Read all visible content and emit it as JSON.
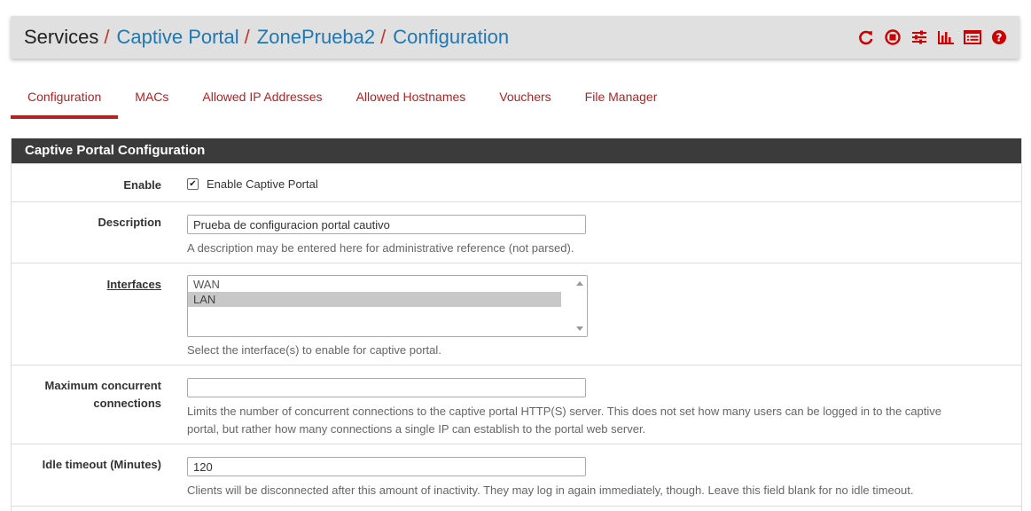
{
  "breadcrumb": {
    "root": "Services",
    "separator": "/",
    "items": [
      "Captive Portal",
      "ZonePrueba2",
      "Configuration"
    ]
  },
  "header_icons": [
    "reload-icon",
    "stop-icon",
    "sliders-icon",
    "bar-chart-icon",
    "log-list-icon",
    "help-icon"
  ],
  "tabs": [
    {
      "label": "Configuration",
      "active": true
    },
    {
      "label": "MACs"
    },
    {
      "label": "Allowed IP Addresses"
    },
    {
      "label": "Allowed Hostnames"
    },
    {
      "label": "Vouchers"
    },
    {
      "label": "File Manager"
    }
  ],
  "panel": {
    "title": "Captive Portal Configuration"
  },
  "form": {
    "enable": {
      "label": "Enable",
      "checkbox_label": "Enable Captive Portal",
      "checked": true,
      "check_glyph": "✔"
    },
    "description": {
      "label": "Description",
      "value": "Prueba de configuracion portal cautivo",
      "help": "A description may be entered here for administrative reference (not parsed)."
    },
    "interfaces": {
      "label": "Interfaces",
      "options": [
        "WAN",
        "LAN"
      ],
      "selected": "LAN",
      "help": "Select the interface(s) to enable for captive portal."
    },
    "max_connections": {
      "label_line1": "Maximum concurrent",
      "label_line2": "connections",
      "value": "",
      "help_line1": "Limits the number of concurrent connections to the captive portal HTTP(S) server. This does not set how many users can be logged in to the captive",
      "help_line2": "portal, but rather how many connections a single IP can establish to the portal web server."
    },
    "idle_timeout": {
      "label": "Idle timeout (Minutes)",
      "value": "120",
      "help": "Clients will be disconnected after this amount of inactivity. They may log in again immediately, though. Leave this field blank for no idle timeout."
    }
  },
  "colors": {
    "link": "#1f77b4",
    "accent_red": "#b22222",
    "panel_heading": "#3b3b3b",
    "header_bg": "#e0e0e0"
  }
}
